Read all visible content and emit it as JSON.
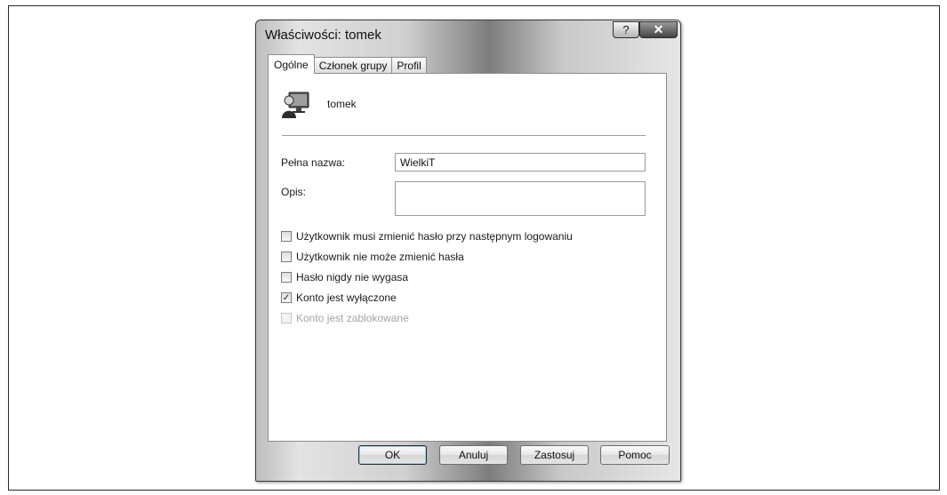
{
  "window": {
    "title": "Właściwości: tomek",
    "help_label": "?",
    "close_label": "✕"
  },
  "tabs": [
    {
      "label": "Ogólne",
      "active": true
    },
    {
      "label": "Członek grupy",
      "active": false
    },
    {
      "label": "Profil",
      "active": false
    }
  ],
  "user": {
    "name": "tomek",
    "icon": "user-account-icon"
  },
  "form": {
    "full_name_label": "Pełna nazwa:",
    "full_name_value": "WielkiT",
    "description_label": "Opis:",
    "description_value": ""
  },
  "checkboxes": [
    {
      "label": "Użytkownik musi zmienić hasło przy następnym logowaniu",
      "checked": false,
      "enabled": true
    },
    {
      "label": "Użytkownik nie może zmienić hasła",
      "checked": false,
      "enabled": true
    },
    {
      "label": "Hasło nigdy nie wygasa",
      "checked": false,
      "enabled": true
    },
    {
      "label": "Konto jest wyłączone",
      "checked": true,
      "enabled": true
    },
    {
      "label": "Konto jest zablokowane",
      "checked": false,
      "enabled": false
    }
  ],
  "buttons": {
    "ok": "OK",
    "cancel": "Anuluj",
    "apply": "Zastosuj",
    "help": "Pomoc"
  }
}
